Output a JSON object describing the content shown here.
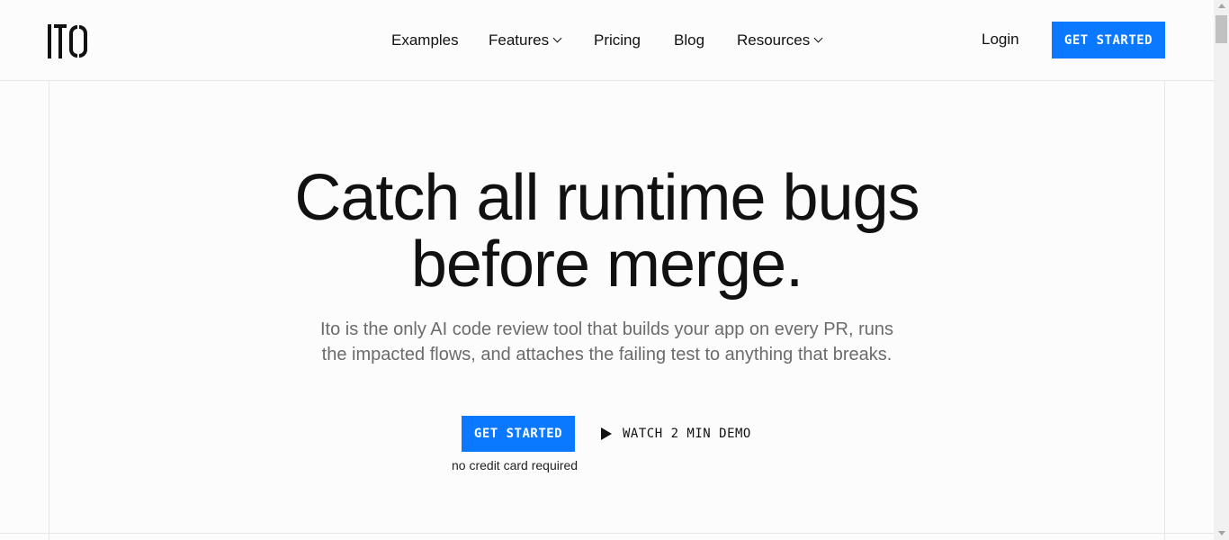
{
  "header": {
    "logo_alt": "ITO",
    "nav": [
      {
        "label": "Examples",
        "has_dropdown": false
      },
      {
        "label": "Features",
        "has_dropdown": true
      },
      {
        "label": "Pricing",
        "has_dropdown": false
      },
      {
        "label": "Blog",
        "has_dropdown": false
      },
      {
        "label": "Resources",
        "has_dropdown": true
      }
    ],
    "login_label": "Login",
    "cta_label": "GET STARTED"
  },
  "hero": {
    "title_line1": "Catch all runtime bugs",
    "title_line2": "before merge.",
    "subtitle_line1": "Ito is the only AI code review tool that builds your app on every PR, runs",
    "subtitle_line2": "the impacted flows, and attaches the failing test to anything that breaks.",
    "cta_label": "GET STARTED",
    "cta_note": "no credit card required",
    "demo_label": "WATCH 2 MIN DEMO"
  },
  "colors": {
    "accent": "#0a78ff",
    "text": "#111111",
    "muted": "#6b6b6b",
    "background": "#fcfcfc"
  },
  "icons": [
    "chevron-down-icon",
    "play-icon"
  ]
}
